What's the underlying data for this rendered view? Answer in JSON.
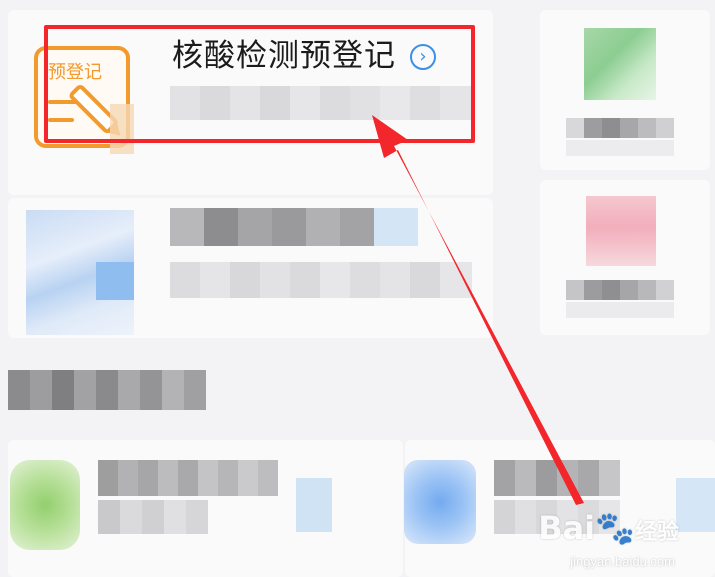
{
  "main_card": {
    "title": "核酸检测预登记",
    "icon_text": "预登记",
    "chevron": "›"
  },
  "watermark": {
    "brand": "Bai",
    "brand_cn": "经验",
    "domain": "jingyan.baidu.com"
  },
  "colors": {
    "highlight": "#f2262b",
    "arrow": "#f2262b",
    "accent_blue": "#3b8fe8",
    "icon_orange": "#f39a2f"
  }
}
